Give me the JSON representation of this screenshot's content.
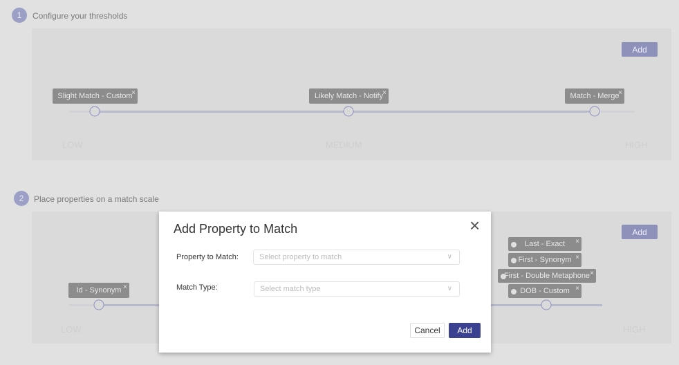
{
  "step1": {
    "number": "1",
    "title": "Configure your thresholds",
    "add_label": "Add",
    "chips": [
      {
        "label": "Slight Match - Custom"
      },
      {
        "label": "Likely Match - Notify"
      },
      {
        "label": "Match - Merge"
      }
    ],
    "scale": {
      "low": "LOW",
      "medium": "MEDIUM",
      "high": "HIGH"
    }
  },
  "step2": {
    "number": "2",
    "title": "Place properties on a match scale",
    "add_label": "Add",
    "chips": [
      {
        "label": "Id - Synonym"
      },
      {
        "label": "Last - Exact"
      },
      {
        "label": "First - Synonym"
      },
      {
        "label": "First - Double Metaphone"
      },
      {
        "label": "DOB - Custom"
      }
    ],
    "scale": {
      "low": "LOW",
      "high": "HIGH"
    }
  },
  "modal": {
    "title": "Add Property to Match",
    "property_label": "Property to Match:",
    "property_placeholder": "Select property to match",
    "match_type_label": "Match Type:",
    "match_type_placeholder": "Select match type",
    "cancel_label": "Cancel",
    "add_label": "Add"
  },
  "icons": {
    "close": "×",
    "chevron": "∨",
    "remove": "×"
  }
}
